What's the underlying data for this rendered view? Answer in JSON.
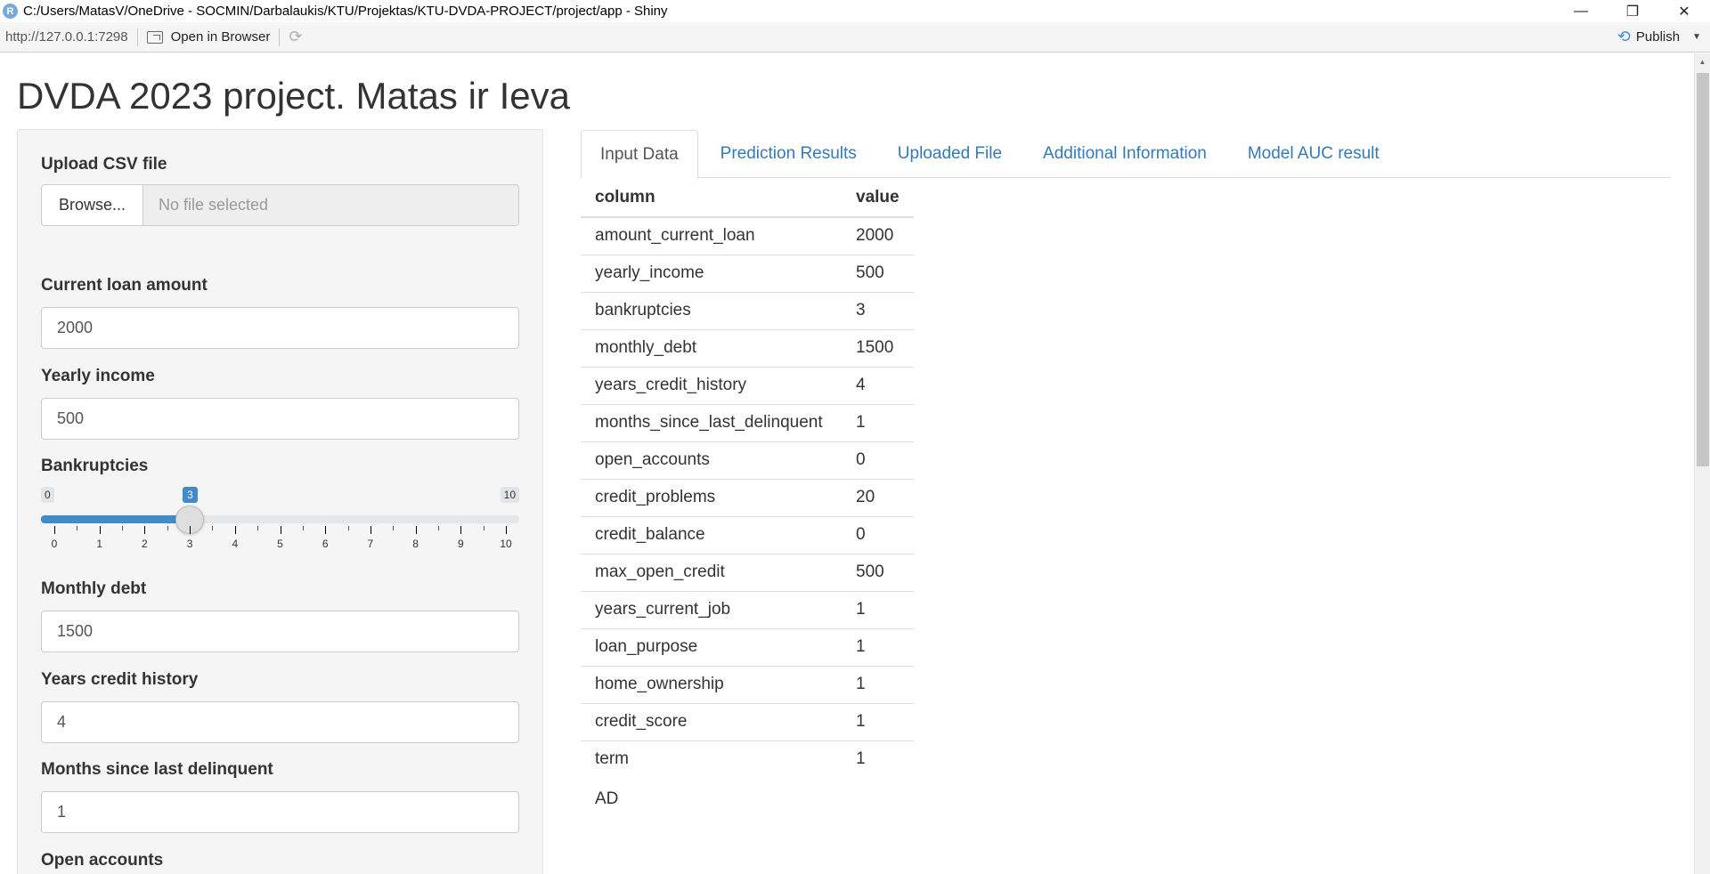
{
  "window": {
    "title": "C:/Users/MatasV/OneDrive - SOCMIN/Darbalaukis/KTU/Projektas/KTU-DVDA-PROJECT/project/app - Shiny",
    "app_icon": "R",
    "minimize": "—",
    "restore": "❐",
    "close": "✕"
  },
  "toolbar": {
    "url": "http://127.0.0.1:7298",
    "open_in_browser": "Open in Browser",
    "publish": "Publish"
  },
  "page": {
    "title": "DVDA 2023 project. Matas ir Ieva"
  },
  "sidebar": {
    "upload": {
      "label": "Upload CSV file",
      "browse": "Browse...",
      "placeholder": "No file selected"
    },
    "current_loan": {
      "label": "Current loan amount",
      "value": "2000"
    },
    "yearly_income": {
      "label": "Yearly income",
      "value": "500"
    },
    "bankruptcies": {
      "label": "Bankruptcies",
      "min": 0,
      "max": 10,
      "value": 3,
      "min_label": "0",
      "max_label": "10",
      "value_label": "3",
      "ticks": [
        "0",
        "1",
        "2",
        "3",
        "4",
        "5",
        "6",
        "7",
        "8",
        "9",
        "10"
      ]
    },
    "monthly_debt": {
      "label": "Monthly debt",
      "value": "1500"
    },
    "years_credit_history": {
      "label": "Years credit history",
      "value": "4"
    },
    "months_since_last_delinquent": {
      "label": "Months since last delinquent",
      "value": "1"
    },
    "open_accounts": {
      "label": "Open accounts"
    }
  },
  "tabs": [
    {
      "label": "Input Data",
      "active": true
    },
    {
      "label": "Prediction Results",
      "active": false
    },
    {
      "label": "Uploaded File",
      "active": false
    },
    {
      "label": "Additional Information",
      "active": false
    },
    {
      "label": "Model AUC result",
      "active": false
    }
  ],
  "table": {
    "headers": [
      "column",
      "value"
    ],
    "rows": [
      [
        "amount_current_loan",
        "2000"
      ],
      [
        "yearly_income",
        "500"
      ],
      [
        "bankruptcies",
        "3"
      ],
      [
        "monthly_debt",
        "1500"
      ],
      [
        "years_credit_history",
        "4"
      ],
      [
        "months_since_last_delinquent",
        "1"
      ],
      [
        "open_accounts",
        "0"
      ],
      [
        "credit_problems",
        "20"
      ],
      [
        "credit_balance",
        "0"
      ],
      [
        "max_open_credit",
        "500"
      ],
      [
        "years_current_job",
        "1"
      ],
      [
        "loan_purpose",
        "1"
      ],
      [
        "home_ownership",
        "1"
      ],
      [
        "credit_score",
        "1"
      ],
      [
        "term",
        "1"
      ]
    ]
  },
  "footer_text": "AD",
  "colors": {
    "accent": "#428bca",
    "link": "#337ab7",
    "sidebar_bg": "#f5f5f5"
  }
}
